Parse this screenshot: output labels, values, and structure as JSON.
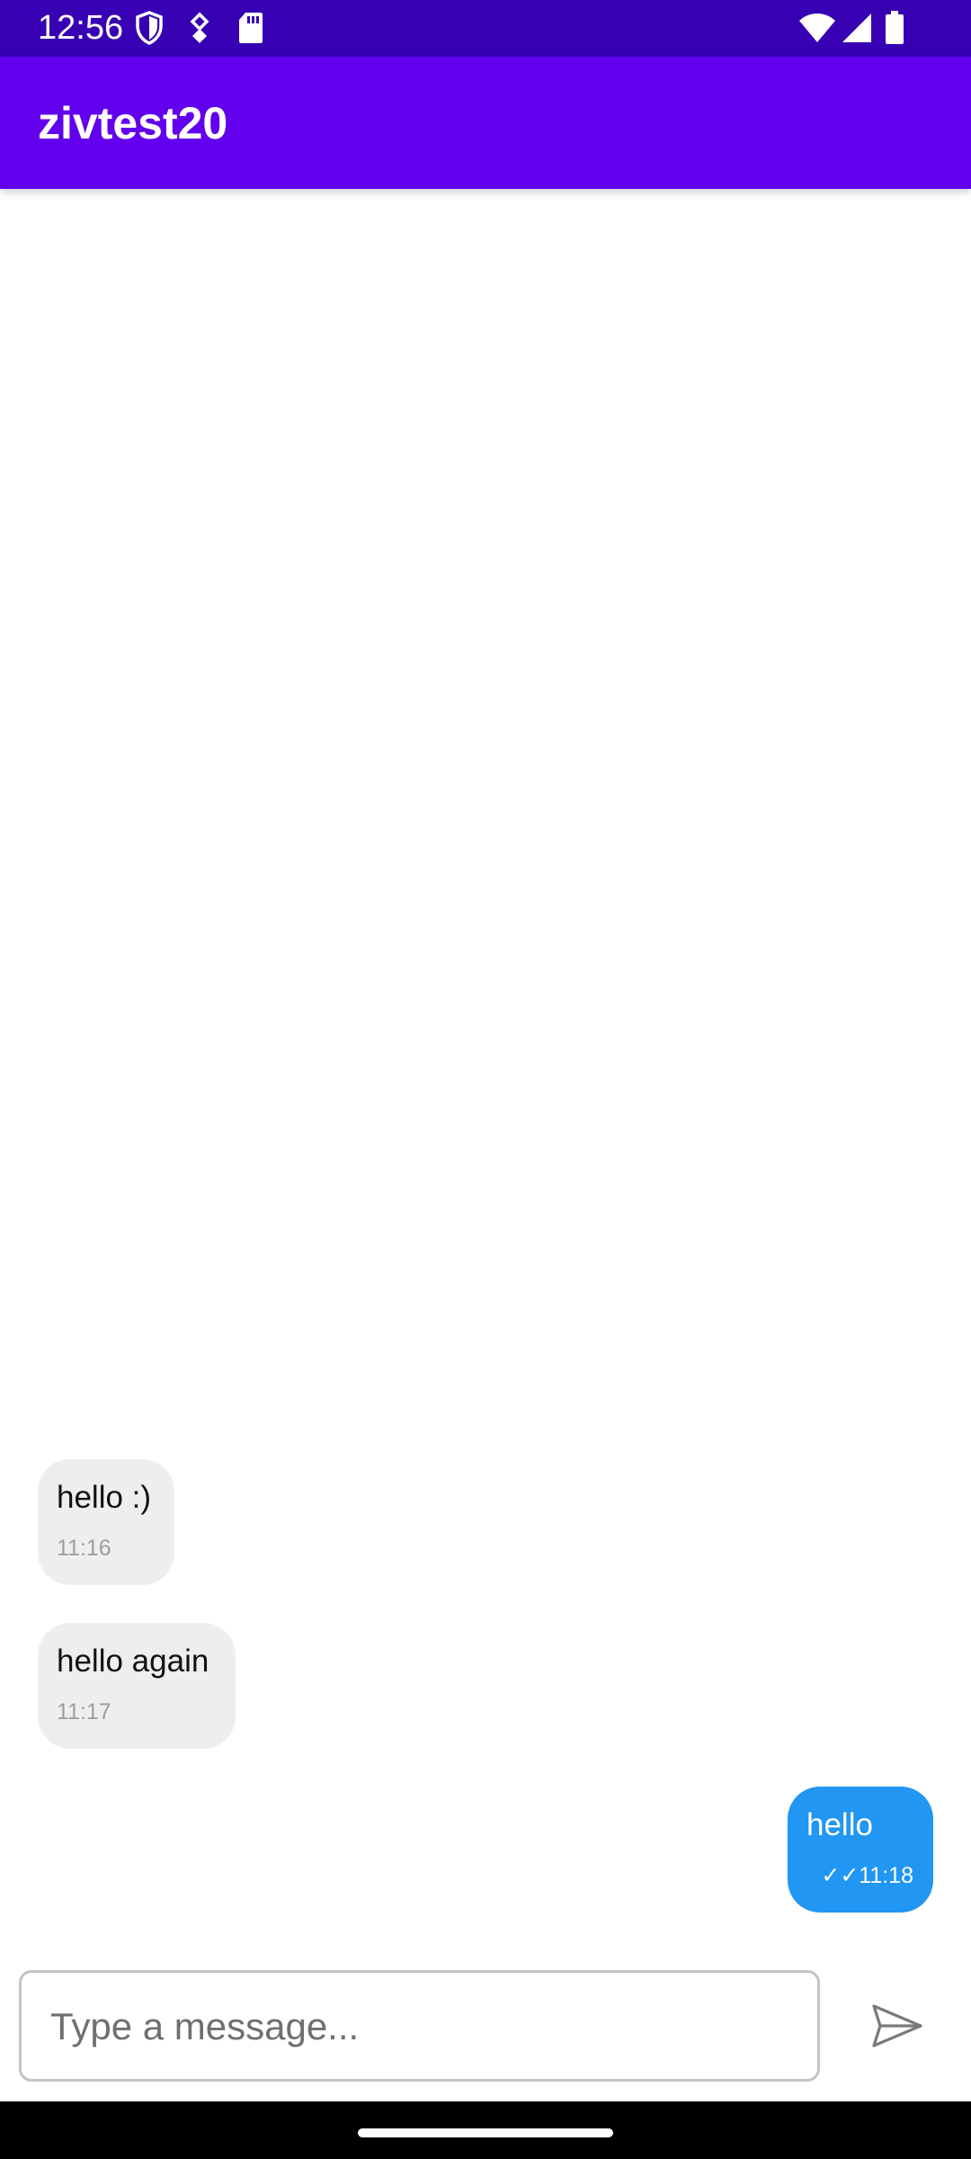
{
  "status_bar": {
    "time": "12:56",
    "left_icons": [
      "shield-icon",
      "data-saver-icon",
      "sd-card-icon"
    ],
    "right_icons": [
      "wifi-icon",
      "signal-icon",
      "battery-icon"
    ]
  },
  "app_bar": {
    "title": "zivtest20",
    "color": "#6200ee"
  },
  "messages": [
    {
      "direction": "incoming",
      "text": "hello :)",
      "time": "11:16"
    },
    {
      "direction": "incoming",
      "text": "hello again",
      "time": "11:17"
    },
    {
      "direction": "outgoing",
      "text": "hello",
      "status": "✓✓",
      "time": "11:18"
    }
  ],
  "composer": {
    "placeholder": "Type a message...",
    "value": "",
    "send_icon": "send-icon"
  },
  "colors": {
    "status_bar": "#3700b3",
    "app_bar": "#6200ee",
    "incoming_bubble": "#eeeeee",
    "outgoing_bubble": "#2196f3"
  }
}
